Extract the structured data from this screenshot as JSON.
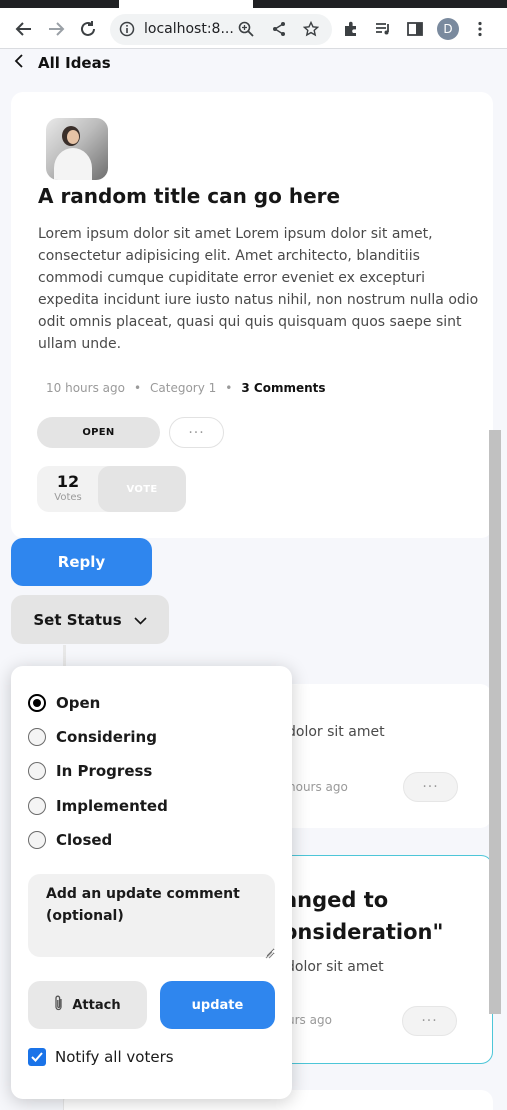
{
  "browser": {
    "url": "localhost:8...",
    "profile_initial": "D",
    "icons": [
      "back-arrow-icon",
      "forward-arrow-icon",
      "reload-icon",
      "site-info-icon",
      "zoom-icon",
      "share-icon",
      "bookmark-star-icon",
      "extensions-icon",
      "media-queue-icon",
      "side-panel-icon",
      "menu-icon"
    ]
  },
  "nav": {
    "back_label": "All Ideas"
  },
  "idea": {
    "title": "A random title can go here",
    "description": "Lorem ipsum dolor sit amet Lorem ipsum dolor sit amet, consectetur adipisicing elit. Amet architecto, blanditiis commodi cumque cupiditate error eveniet ex excepturi expedita incidunt iure iusto natus nihil, non nostrum nulla odio odit omnis placeat, quasi qui quis quisquam quos saepe sint ullam unde.",
    "time": "10 hours ago",
    "separator": "•",
    "category": "Category 1",
    "comments": "3 Comments",
    "status": "OPEN",
    "more": "···",
    "votes_count": "12",
    "votes_label": "Votes",
    "vote_button": "VOTE"
  },
  "actions": {
    "reply": "Reply",
    "set_status": "Set Status"
  },
  "comments": [
    {
      "text": "dolor sit amet",
      "time": "hours ago",
      "more": "···"
    },
    {
      "title_line1": "anged to",
      "title_line2": "onsideration\"",
      "text": "dolor sit amet",
      "time": "urs ago",
      "more": "···"
    }
  ],
  "status_menu": {
    "options": [
      "Open",
      "Considering",
      "In Progress",
      "Implemented",
      "Closed"
    ],
    "selected": "Open",
    "comment_placeholder": "Add an update comment (optional)",
    "attach_label": "Attach",
    "update_label": "update",
    "notify_label": "Notify all voters",
    "notify_checked": true
  },
  "colors": {
    "accent_blue": "#2f86ee",
    "highlight_border": "#4dc6d8",
    "checkbox_blue": "#1a73e8"
  }
}
